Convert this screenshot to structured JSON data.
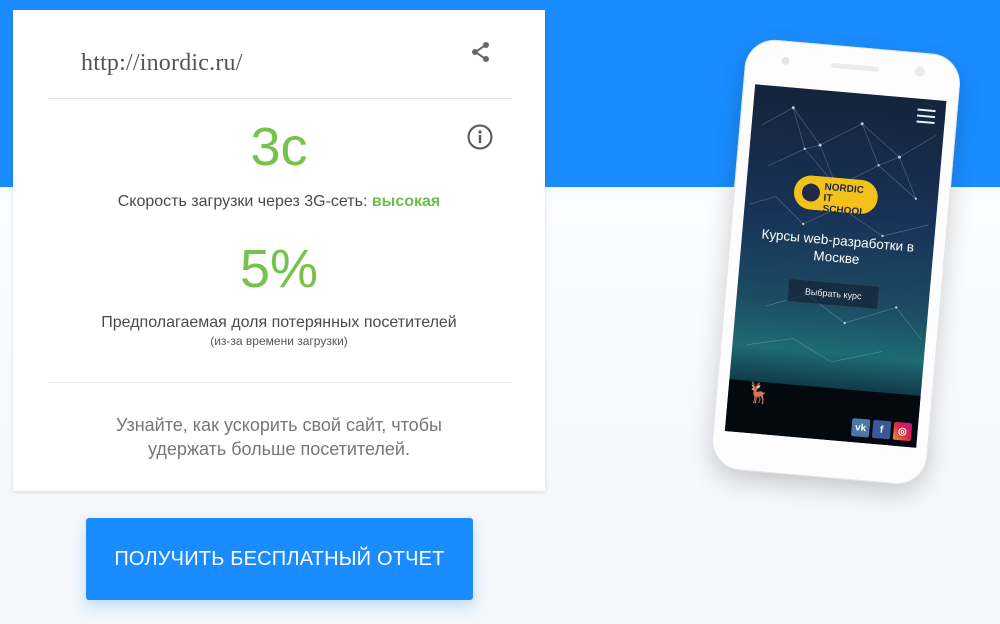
{
  "result": {
    "url": "http://inordic.ru/",
    "load_time": "3с",
    "speed_label": "Скорость загрузки через 3G-сеть: ",
    "speed_rating": "высокая",
    "lost_visitors": "5%",
    "lost_label": "Предполагаемая доля потерянных посетителей",
    "lost_note": "(из-за времени загрузки)",
    "tip": "Узнайте, как ускорить свой сайт, чтобы удержать больше посетителей."
  },
  "cta": {
    "label": "ПОЛУЧИТЬ БЕСПЛАТНЫЙ ОТЧЕТ"
  },
  "phone_preview": {
    "logo_line1": "NORDIC",
    "logo_line2": "IT SCHOOL",
    "headline": "Курсы web-разработки в Москве",
    "button": "Выбрать курс",
    "social": [
      "vk",
      "f",
      "ig"
    ]
  },
  "colors": {
    "accent": "#1a8cff",
    "good": "#76c24c"
  }
}
